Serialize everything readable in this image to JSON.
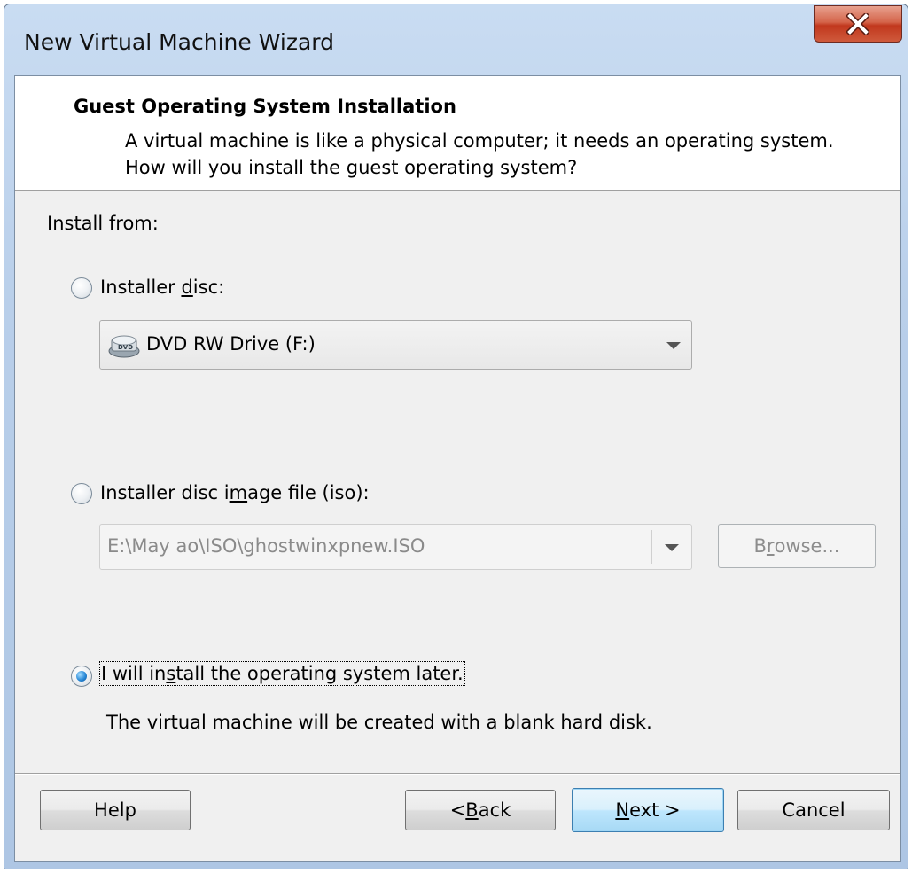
{
  "window": {
    "title": "New Virtual Machine Wizard",
    "close_icon": "close-icon"
  },
  "header": {
    "title": "Guest Operating System Installation",
    "description": "A virtual machine is like a physical computer; it needs an operating system. How will you install the guest operating system?"
  },
  "install_from_label": "Install from:",
  "options": {
    "disc": {
      "label_pre": "Installer ",
      "label_accel": "d",
      "label_post": "isc:",
      "selected": false,
      "combo_value": "DVD RW Drive (F:)",
      "combo_icon": "dvd-drive-icon"
    },
    "iso": {
      "label_pre": "Installer disc i",
      "label_accel": "m",
      "label_post": "age file (iso):",
      "selected": false,
      "combo_value": "E:\\May ao\\ISO\\ghostwinxpnew.ISO",
      "browse_pre": "B",
      "browse_accel": "r",
      "browse_post": "owse..."
    },
    "later": {
      "label_pre": "I will in",
      "label_accel": "s",
      "label_post": "tall the operating system later.",
      "selected": true,
      "description": "The virtual machine will be created with a blank hard disk."
    }
  },
  "buttons": {
    "help": "Help",
    "back_pre": "< ",
    "back_accel": "B",
    "back_post": "ack",
    "next_accel": "N",
    "next_post": "ext >",
    "cancel": "Cancel"
  }
}
